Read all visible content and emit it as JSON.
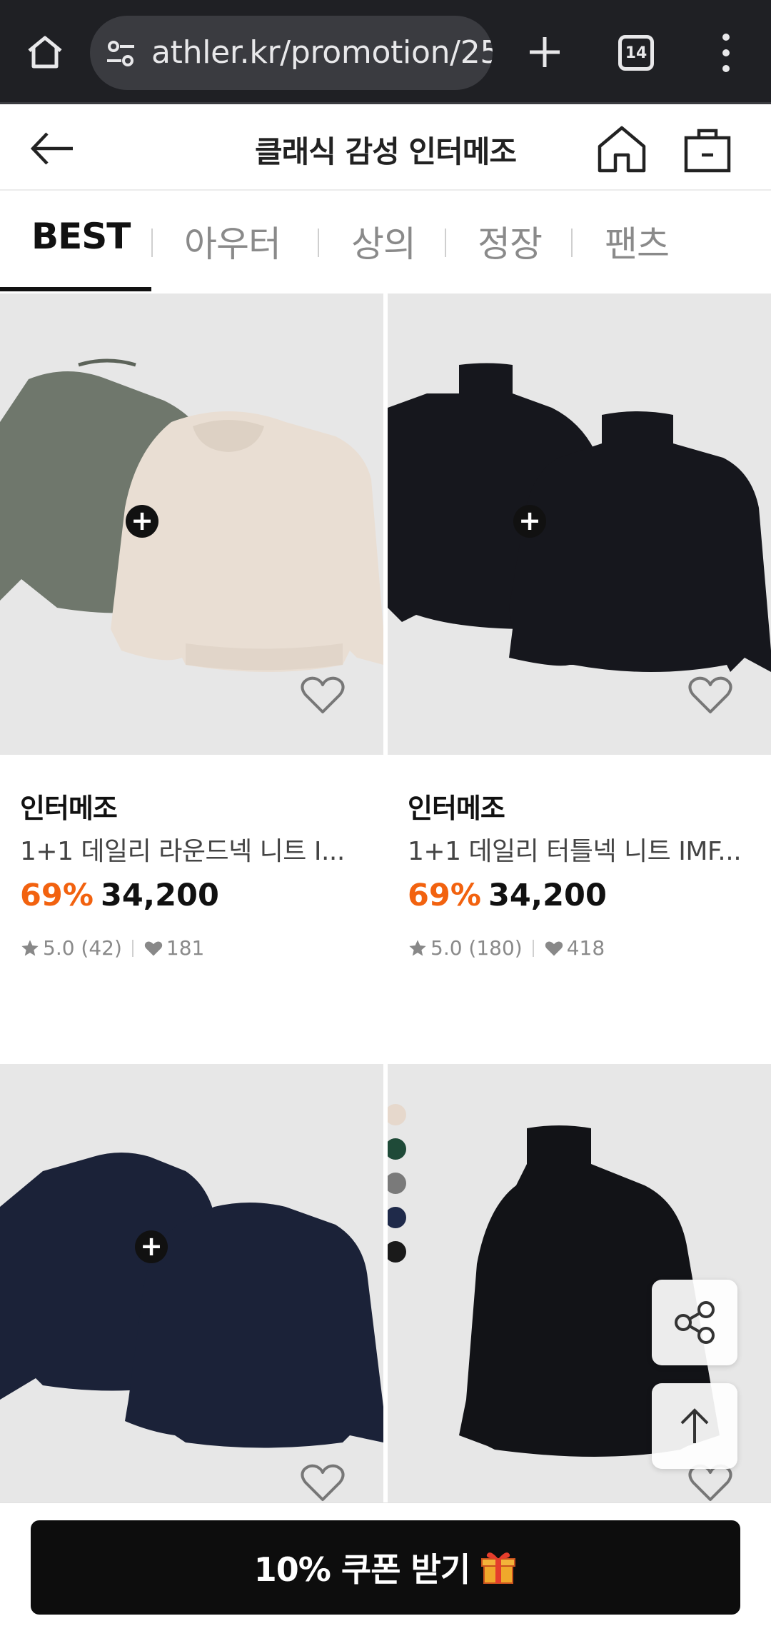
{
  "browser": {
    "url": "athler.kr/promotion/25",
    "tab_count": "14"
  },
  "header": {
    "title": "클래식 감성 인터메조"
  },
  "tabs": [
    "BEST",
    "아우터",
    "상의",
    "정장",
    "팬츠"
  ],
  "active_tab": "BEST",
  "products": [
    {
      "brand": "인터메조",
      "name": "1+1 데일리 라운드넥 니트 I...",
      "discount": "69%",
      "price": "34,200",
      "rating": "5.0 (42)",
      "likes": "181",
      "colors": [
        "#6f776c",
        "#e9ded3"
      ]
    },
    {
      "brand": "인터메조",
      "name": "1+1 데일리 터틀넥 니트 IMF...",
      "discount": "69%",
      "price": "34,200",
      "rating": "5.0 (180)",
      "likes": "418",
      "colors": [
        "#16171d",
        "#16171d"
      ]
    },
    {
      "colors": [
        "#1b2238",
        "#1b2238"
      ]
    },
    {
      "colors": [
        "#121317"
      ],
      "swatches": [
        "#e6d8cc",
        "#1f4a38",
        "#7a7a7a",
        "#1f2a4a",
        "#1a1a1a"
      ]
    }
  ],
  "coupon": {
    "label": "10% 쿠폰 받기"
  },
  "accent_color": "#f2620f"
}
